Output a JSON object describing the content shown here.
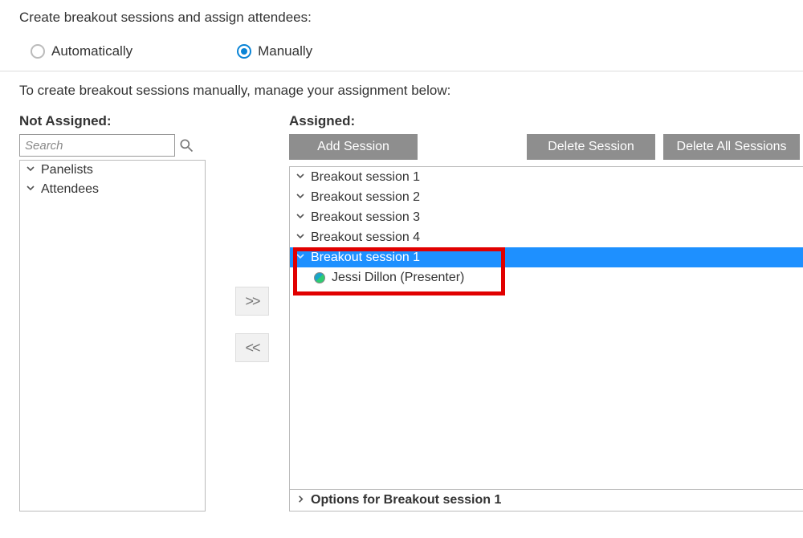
{
  "header": "Create breakout sessions and assign attendees:",
  "radio": {
    "auto": "Automatically",
    "manual": "Manually",
    "selected": "manual"
  },
  "subtext": "To create breakout sessions manually, manage your assignment below:",
  "notAssigned": {
    "heading": "Not Assigned:",
    "searchPlaceholder": "Search",
    "groups": [
      {
        "label": "Panelists"
      },
      {
        "label": "Attendees"
      }
    ]
  },
  "assigned": {
    "heading": "Assigned:",
    "buttons": {
      "add": "Add Session",
      "delete": "Delete Session",
      "deleteAll": "Delete All Sessions"
    },
    "sessions": [
      {
        "label": "Breakout session 1",
        "selected": false
      },
      {
        "label": "Breakout session 2",
        "selected": false
      },
      {
        "label": "Breakout session 3",
        "selected": false
      },
      {
        "label": "Breakout session 4",
        "selected": false
      },
      {
        "label": "Breakout session 1",
        "selected": true
      }
    ],
    "selectedAttendee": "Jessi Dillon (Presenter)",
    "optionsFooter": "Options for Breakout session 1"
  },
  "transfer": {
    "right": ">>",
    "left": "<<"
  }
}
